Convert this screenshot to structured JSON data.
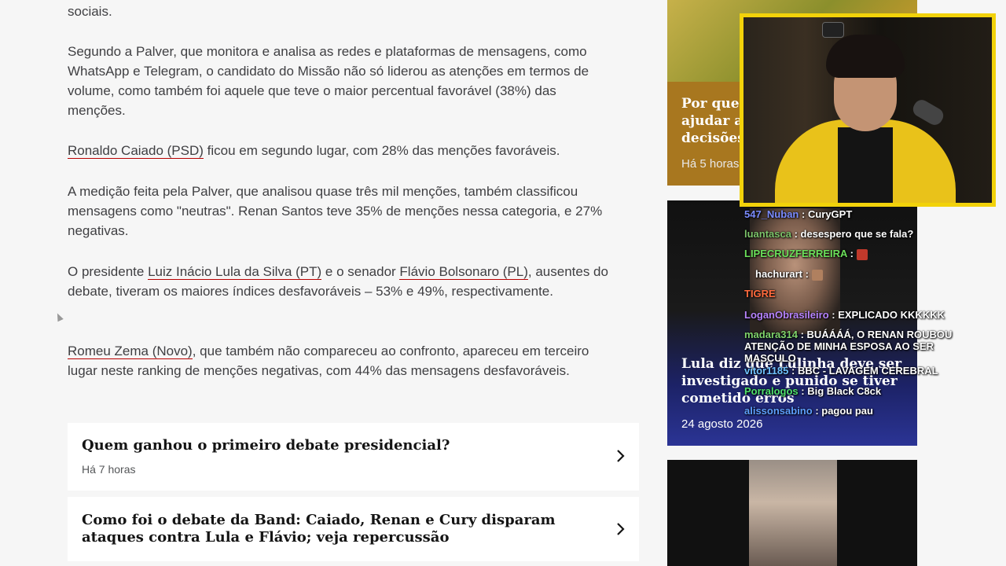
{
  "article": {
    "p0": "sociais.",
    "p1": "Segundo a Palver, que monitora e analisa as redes e plataformas de mensagens, como WhatsApp e Telegram, o candidato do Missão não só liderou as atenções em termos de volume, como também foi aquele que teve o maior percentual favorável (38%) das menções.",
    "p2_link": "Ronaldo Caiado (PSD)",
    "p2_rest": " ficou em segundo lugar, com 28% das menções favoráveis.",
    "p3": "A medição feita pela Palver, que analisou quase três mil menções, também classificou mensagens como \"neutras\". Renan Santos teve 35% de menções nessa categoria, e 27% negativas.",
    "p4_a": "O presidente ",
    "p4_link1": "Luiz Inácio Lula da Silva (PT)",
    "p4_b": " e o senador ",
    "p4_link2": "Flávio Bolsonaro (PL)",
    "p4_c": ", ausentes do debate, tiveram os maiores índices desfavoráveis – 53% e 49%, respectivamente.",
    "p5_link": "Romeu Zema (Novo)",
    "p5_rest": ", que também não compareceu ao confronto, apareceu em terceiro lugar neste ranking de menções negativas, com 44% das mensagens desfavoráveis."
  },
  "related": [
    {
      "title": "Quem ganhou o primeiro debate presidencial?",
      "meta": "Há 7 horas"
    },
    {
      "title": "Como foi o debate da Band: Caiado, Renan e Cury disparam ataques contra Lula e Flávio; veja repercussão",
      "meta": ""
    }
  ],
  "sidebar": {
    "item1": {
      "title_l1": "Por que",
      "title_l2": "ajudar a",
      "title_l3": "decisões",
      "meta": "Há 5 horas"
    },
    "item2": {
      "title": "Lula diz que Lulinha deve ser investigado e punido se tiver cometido erros",
      "meta": "24 agosto 2026"
    }
  },
  "chat": [
    {
      "user": "547_Nuban",
      "msg": "CuryGPT",
      "color": "#7b8cff"
    },
    {
      "user": "luantasca",
      "msg": "desespero que se fala?",
      "color": "#7cc36a"
    },
    {
      "user": "LIPECRUZFERREIRA",
      "msg": "",
      "color": "#6be05a"
    },
    {
      "user": "hachurart",
      "msg": "",
      "color": "#ffffff"
    },
    {
      "user": "TIGRE",
      "msg": "",
      "color": "#ff6a3d"
    },
    {
      "user": "LoganObrasileiro",
      "msg": "EXPLICADO KKKKKK",
      "color": "#b784ff"
    },
    {
      "user": "madara314",
      "msg": "BUÁÁÁÁ, O RENAN ROUBOU ATENÇÃO DE MINHA ESPOSA AO SER MASCULO",
      "color": "#7fd36b"
    },
    {
      "user": "vitor1185",
      "msg": "BBC - LAVAGEM CEREBRAL",
      "color": "#6fc2ff"
    },
    {
      "user": "Porralogos",
      "msg": "Big Black C8ck",
      "color": "#4fe06a"
    },
    {
      "user": "alissonsabino",
      "msg": "pagou pau",
      "color": "#5ea0ff"
    }
  ],
  "colors": {
    "webcam_border": "#f2d20a",
    "link_underline": "#b80000"
  }
}
